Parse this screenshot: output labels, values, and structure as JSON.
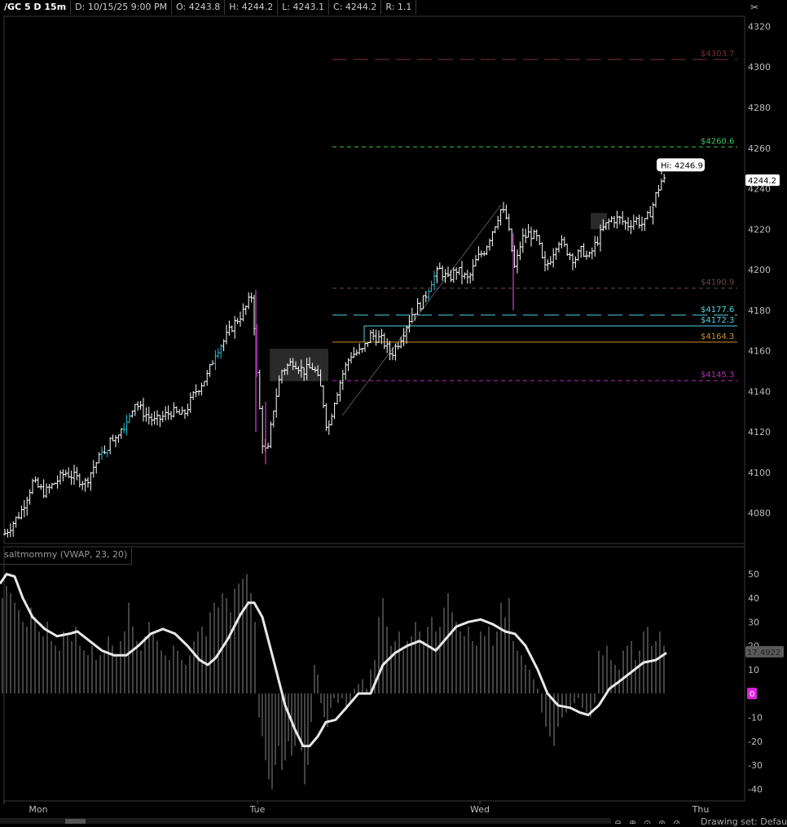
{
  "header": {
    "symbol": "/GC 5 D 15m",
    "date": "D: 10/15/25 9:00 PM",
    "open": "O: 4243.8",
    "high": "H: 4244.2",
    "low": "L: 4243.1",
    "close": "C: 4244.2",
    "range": "R: 1.1"
  },
  "study": {
    "title": "saltmommy (VWAP, 23, 20)"
  },
  "footer": {
    "drawing_set": "Drawing set: Default"
  },
  "colors": {
    "background": "#000000",
    "candle": "#ffffff",
    "candle_highlight": "#22c3d6",
    "candle_alt": "#cc33cc",
    "level_red": "#7a2f3a",
    "level_green": "#39c65a",
    "level_gray": "#6b4b4b",
    "level_cyan": "#4fd3e0",
    "level_orange": "#c8902a",
    "level_magenta": "#b52eb5"
  },
  "chart_data": [
    {
      "type": "candlestick",
      "title": "/GC 5 D 15m",
      "x_labels": [
        "Mon",
        "Tue",
        "Wed",
        "Thu"
      ],
      "ylim": [
        4065,
        4325
      ],
      "y_ticks": [
        4080,
        4100,
        4120,
        4140,
        4160,
        4180,
        4200,
        4220,
        4240,
        4260,
        4280,
        4300,
        4320
      ],
      "last_price": "4244.2",
      "annotation": "Hi: 4246.9",
      "close_path": [
        [
          0,
          4067
        ],
        [
          10,
          4072
        ],
        [
          25,
          4080
        ],
        [
          40,
          4095
        ],
        [
          55,
          4090
        ],
        [
          80,
          4100
        ],
        [
          105,
          4095
        ],
        [
          115,
          4103
        ],
        [
          135,
          4115
        ],
        [
          155,
          4125
        ],
        [
          165,
          4135
        ],
        [
          175,
          4130
        ],
        [
          190,
          4125
        ],
        [
          210,
          4130
        ],
        [
          225,
          4128
        ],
        [
          240,
          4140
        ],
        [
          255,
          4148
        ],
        [
          265,
          4160
        ],
        [
          275,
          4165
        ],
        [
          285,
          4172
        ],
        [
          300,
          4180
        ],
        [
          310,
          4188
        ],
        [
          315,
          4150
        ],
        [
          322,
          4115
        ],
        [
          328,
          4108
        ],
        [
          335,
          4130
        ],
        [
          345,
          4150
        ],
        [
          360,
          4155
        ],
        [
          372,
          4150
        ],
        [
          385,
          4152
        ],
        [
          395,
          4140
        ],
        [
          402,
          4120
        ],
        [
          410,
          4135
        ],
        [
          420,
          4148
        ],
        [
          430,
          4158
        ],
        [
          445,
          4160
        ],
        [
          455,
          4168
        ],
        [
          470,
          4165
        ],
        [
          480,
          4158
        ],
        [
          490,
          4165
        ],
        [
          505,
          4178
        ],
        [
          520,
          4185
        ],
        [
          530,
          4195
        ],
        [
          540,
          4200
        ],
        [
          550,
          4195
        ],
        [
          560,
          4200
        ],
        [
          575,
          4195
        ],
        [
          585,
          4205
        ],
        [
          595,
          4210
        ],
        [
          605,
          4220
        ],
        [
          615,
          4230
        ],
        [
          622,
          4225
        ],
        [
          628,
          4210
        ],
        [
          632,
          4200
        ],
        [
          640,
          4215
        ],
        [
          650,
          4218
        ],
        [
          660,
          4215
        ],
        [
          668,
          4200
        ],
        [
          675,
          4205
        ],
        [
          685,
          4215
        ],
        [
          695,
          4210
        ],
        [
          705,
          4205
        ],
        [
          715,
          4210
        ],
        [
          722,
          4205
        ],
        [
          730,
          4212
        ],
        [
          740,
          4220
        ],
        [
          750,
          4225
        ],
        [
          760,
          4225
        ],
        [
          770,
          4222
        ],
        [
          780,
          4225
        ],
        [
          790,
          4222
        ],
        [
          800,
          4230
        ],
        [
          806,
          4238
        ],
        [
          812,
          4244
        ],
        [
          816,
          4244
        ]
      ],
      "levels": [
        {
          "label": "$4303.7",
          "value": 4303.7,
          "color": "#7a2f3a",
          "style": "long-dash"
        },
        {
          "label": "$4260.6",
          "value": 4260.6,
          "color": "#39c65a",
          "style": "dash"
        },
        {
          "label": "$4190.9",
          "value": 4190.9,
          "color": "#6b4b4b",
          "style": "dash"
        },
        {
          "label": "$4177.6",
          "value": 4177.6,
          "color": "#4fd3e0",
          "style": "long-dash"
        },
        {
          "label": "$4172.3",
          "value": 4172.3,
          "color": "#4fd3e0",
          "style": "solid"
        },
        {
          "label": "$4164.3",
          "value": 4164.3,
          "color": "#c8902a",
          "style": "solid"
        },
        {
          "label": "$4145.3",
          "value": 4145.3,
          "color": "#b52eb5",
          "style": "dash"
        }
      ]
    },
    {
      "type": "line",
      "title": "saltmommy (VWAP, 23, 20)",
      "ylim": [
        -45,
        55
      ],
      "y_ticks": [
        -40,
        -30,
        -20,
        -10,
        0,
        10,
        20,
        30,
        40,
        50
      ],
      "last_value": "17.4922",
      "zero_label": "0",
      "line": [
        [
          0,
          46
        ],
        [
          8,
          50
        ],
        [
          18,
          49
        ],
        [
          28,
          40
        ],
        [
          40,
          32
        ],
        [
          55,
          27
        ],
        [
          70,
          24
        ],
        [
          85,
          25
        ],
        [
          95,
          26
        ],
        [
          110,
          22
        ],
        [
          125,
          18
        ],
        [
          140,
          16
        ],
        [
          155,
          16
        ],
        [
          170,
          20
        ],
        [
          185,
          25
        ],
        [
          200,
          27
        ],
        [
          215,
          25
        ],
        [
          230,
          20
        ],
        [
          245,
          14
        ],
        [
          255,
          12
        ],
        [
          265,
          15
        ],
        [
          280,
          23
        ],
        [
          295,
          33
        ],
        [
          305,
          38
        ],
        [
          312,
          38
        ],
        [
          322,
          32
        ],
        [
          335,
          15
        ],
        [
          350,
          -5
        ],
        [
          362,
          -15
        ],
        [
          372,
          -22
        ],
        [
          380,
          -22
        ],
        [
          390,
          -18
        ],
        [
          400,
          -12
        ],
        [
          412,
          -11
        ],
        [
          425,
          -6
        ],
        [
          440,
          0
        ],
        [
          455,
          0
        ],
        [
          470,
          12
        ],
        [
          485,
          17
        ],
        [
          500,
          20
        ],
        [
          515,
          22
        ],
        [
          525,
          20
        ],
        [
          535,
          18
        ],
        [
          545,
          22
        ],
        [
          560,
          28
        ],
        [
          575,
          30
        ],
        [
          590,
          31
        ],
        [
          605,
          29
        ],
        [
          620,
          26
        ],
        [
          632,
          25
        ],
        [
          645,
          20
        ],
        [
          660,
          10
        ],
        [
          672,
          0
        ],
        [
          685,
          -5
        ],
        [
          700,
          -6
        ],
        [
          712,
          -8
        ],
        [
          722,
          -9
        ],
        [
          735,
          -5
        ],
        [
          748,
          2
        ],
        [
          760,
          5
        ],
        [
          775,
          9
        ],
        [
          790,
          13
        ],
        [
          805,
          14
        ],
        [
          818,
          17
        ]
      ],
      "histogram": [
        [
          3,
          40
        ],
        [
          8,
          45
        ],
        [
          13,
          42
        ],
        [
          18,
          38
        ],
        [
          23,
          35
        ],
        [
          28,
          30
        ],
        [
          33,
          28
        ],
        [
          38,
          36
        ],
        [
          43,
          32
        ],
        [
          48,
          26
        ],
        [
          53,
          24
        ],
        [
          58,
          30
        ],
        [
          63,
          22
        ],
        [
          68,
          20
        ],
        [
          73,
          18
        ],
        [
          78,
          26
        ],
        [
          83,
          24
        ],
        [
          88,
          22
        ],
        [
          93,
          28
        ],
        [
          98,
          20
        ],
        [
          103,
          18
        ],
        [
          108,
          16
        ],
        [
          113,
          20
        ],
        [
          118,
          14
        ],
        [
          123,
          16
        ],
        [
          128,
          18
        ],
        [
          133,
          24
        ],
        [
          138,
          20
        ],
        [
          143,
          16
        ],
        [
          148,
          22
        ],
        [
          153,
          26
        ],
        [
          158,
          38
        ],
        [
          163,
          28
        ],
        [
          168,
          22
        ],
        [
          173,
          18
        ],
        [
          178,
          24
        ],
        [
          183,
          30
        ],
        [
          188,
          26
        ],
        [
          193,
          22
        ],
        [
          198,
          18
        ],
        [
          203,
          16
        ],
        [
          208,
          14
        ],
        [
          213,
          20
        ],
        [
          218,
          18
        ],
        [
          223,
          14
        ],
        [
          228,
          12
        ],
        [
          233,
          16
        ],
        [
          238,
          22
        ],
        [
          243,
          26
        ],
        [
          248,
          28
        ],
        [
          253,
          24
        ],
        [
          258,
          34
        ],
        [
          263,
          38
        ],
        [
          268,
          36
        ],
        [
          273,
          42
        ],
        [
          278,
          40
        ],
        [
          283,
          34
        ],
        [
          288,
          44
        ],
        [
          293,
          46
        ],
        [
          298,
          48
        ],
        [
          303,
          50
        ],
        [
          308,
          42
        ],
        [
          313,
          30
        ],
        [
          318,
          -10
        ],
        [
          322,
          -18
        ],
        [
          326,
          -28
        ],
        [
          330,
          -36
        ],
        [
          334,
          -40
        ],
        [
          338,
          -30
        ],
        [
          342,
          -22
        ],
        [
          346,
          -32
        ],
        [
          350,
          -28
        ],
        [
          354,
          -20
        ],
        [
          358,
          -26
        ],
        [
          362,
          -22
        ],
        [
          366,
          -18
        ],
        [
          370,
          -24
        ],
        [
          374,
          -38
        ],
        [
          378,
          -30
        ],
        [
          382,
          -12
        ],
        [
          386,
          12
        ],
        [
          390,
          8
        ],
        [
          394,
          -4
        ],
        [
          398,
          -10
        ],
        [
          402,
          -14
        ],
        [
          406,
          -6
        ],
        [
          410,
          -2
        ],
        [
          415,
          -4
        ],
        [
          420,
          -2
        ],
        [
          425,
          -6
        ],
        [
          430,
          -4
        ],
        [
          435,
          2
        ],
        [
          440,
          4
        ],
        [
          445,
          6
        ],
        [
          450,
          2
        ],
        [
          455,
          10
        ],
        [
          460,
          14
        ],
        [
          465,
          32
        ],
        [
          470,
          40
        ],
        [
          475,
          28
        ],
        [
          480,
          20
        ],
        [
          485,
          22
        ],
        [
          490,
          26
        ],
        [
          495,
          18
        ],
        [
          500,
          22
        ],
        [
          505,
          24
        ],
        [
          510,
          30
        ],
        [
          515,
          26
        ],
        [
          520,
          22
        ],
        [
          525,
          28
        ],
        [
          530,
          32
        ],
        [
          535,
          26
        ],
        [
          540,
          28
        ],
        [
          545,
          36
        ],
        [
          550,
          42
        ],
        [
          555,
          34
        ],
        [
          560,
          30
        ],
        [
          565,
          26
        ],
        [
          570,
          24
        ],
        [
          575,
          28
        ],
        [
          580,
          22
        ],
        [
          585,
          20
        ],
        [
          590,
          26
        ],
        [
          595,
          24
        ],
        [
          600,
          28
        ],
        [
          605,
          20
        ],
        [
          610,
          26
        ],
        [
          615,
          38
        ],
        [
          620,
          32
        ],
        [
          625,
          40
        ],
        [
          630,
          22
        ],
        [
          635,
          18
        ],
        [
          640,
          16
        ],
        [
          645,
          12
        ],
        [
          650,
          10
        ],
        [
          655,
          6
        ],
        [
          660,
          2
        ],
        [
          665,
          -8
        ],
        [
          670,
          -14
        ],
        [
          675,
          -18
        ],
        [
          680,
          -22
        ],
        [
          685,
          -14
        ],
        [
          690,
          -10
        ],
        [
          695,
          -8
        ],
        [
          700,
          -6
        ],
        [
          705,
          -4
        ],
        [
          710,
          -2
        ],
        [
          715,
          -6
        ],
        [
          720,
          -8
        ],
        [
          725,
          -10
        ],
        [
          730,
          -4
        ],
        [
          735,
          18
        ],
        [
          740,
          16
        ],
        [
          745,
          20
        ],
        [
          750,
          14
        ],
        [
          755,
          12
        ],
        [
          760,
          10
        ],
        [
          765,
          18
        ],
        [
          770,
          20
        ],
        [
          775,
          22
        ],
        [
          780,
          14
        ],
        [
          785,
          18
        ],
        [
          790,
          26
        ],
        [
          795,
          28
        ],
        [
          800,
          20
        ],
        [
          805,
          22
        ],
        [
          810,
          26
        ],
        [
          815,
          20
        ]
      ]
    }
  ]
}
